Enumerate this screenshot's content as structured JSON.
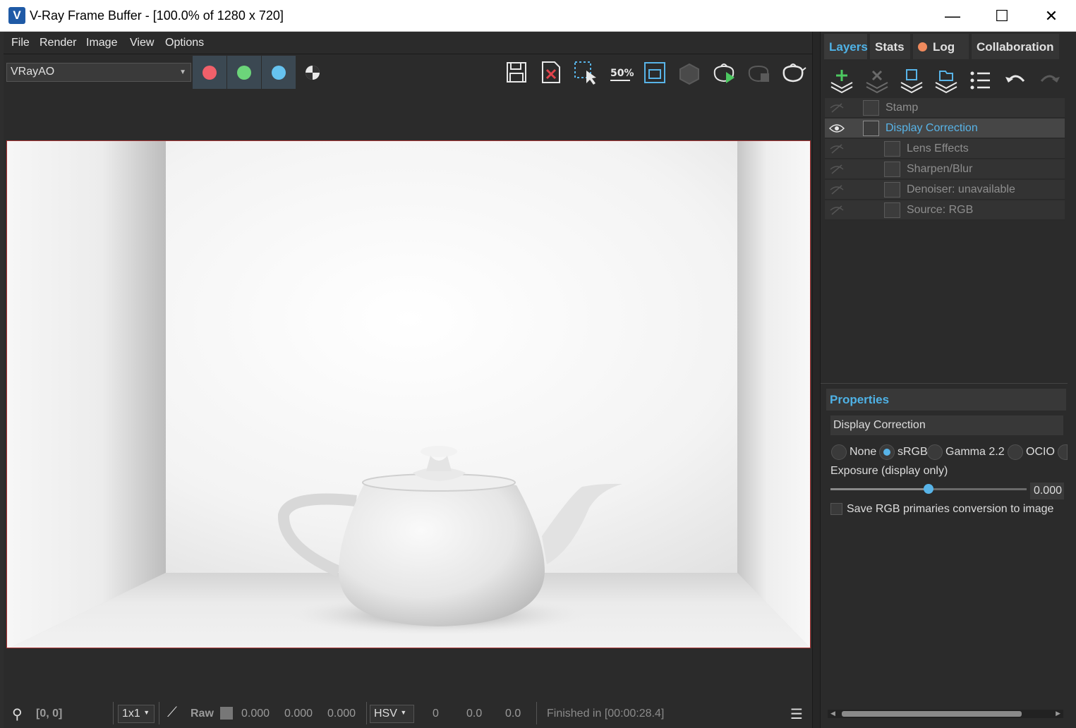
{
  "window": {
    "title": "V-Ray Frame Buffer - [100.0% of 1280 x 720]",
    "icon_letter": "V",
    "minimize": "—",
    "maximize": "☐",
    "close": "✕"
  },
  "menu": [
    "File",
    "Render",
    "Image",
    "View",
    "Options"
  ],
  "toolbar": {
    "channel": "VRayAO",
    "channel_dots": [
      {
        "name": "red-channel",
        "color": "#f0606a"
      },
      {
        "name": "green-channel",
        "color": "#6cd57a"
      },
      {
        "name": "blue-channel",
        "color": "#66c3f0"
      }
    ],
    "zoom_label": "50%",
    "icons": [
      "save-image-icon",
      "clear-image-icon",
      "region-select-icon",
      "zoom-50-icon",
      "track-mouse-icon",
      "render-region-icon",
      "interactive-render-icon",
      "stop-render-icon",
      "render-icon"
    ]
  },
  "statusbar": {
    "coords": "[0, 0]",
    "sample_size": "1x1",
    "mode": "Raw",
    "r": "0.000",
    "g": "0.000",
    "b": "0.000",
    "color_space": "HSV",
    "h": "0",
    "s": "0.0",
    "v": "0.0",
    "status": "Finished in [00:00:28.4]"
  },
  "panel": {
    "tabs": [
      "Layers",
      "Stats",
      "Log",
      "Collaboration"
    ],
    "layer_tools": [
      "add-layer-icon",
      "delete-layer-icon",
      "save-layers-icon",
      "load-layers-icon",
      "layer-list-icon",
      "undo-icon",
      "redo-icon"
    ],
    "layers": [
      {
        "label": "Stamp",
        "visible": false,
        "selected": false,
        "indent": 0
      },
      {
        "label": "Display Correction",
        "visible": true,
        "selected": true,
        "indent": 0
      },
      {
        "label": "Lens Effects",
        "visible": false,
        "selected": false,
        "indent": 1
      },
      {
        "label": "Sharpen/Blur",
        "visible": false,
        "selected": false,
        "indent": 1
      },
      {
        "label": "Denoiser: unavailable",
        "visible": false,
        "selected": false,
        "indent": 1
      },
      {
        "label": "Source: RGB",
        "visible": false,
        "selected": false,
        "indent": 1
      }
    ]
  },
  "properties": {
    "title": "Properties",
    "layer_name": "Display Correction",
    "options": [
      "None",
      "sRGB",
      "Gamma 2.2",
      "OCIO"
    ],
    "selected_option": "sRGB",
    "exposure_label": "Exposure (display only)",
    "exposure_value": "0.000",
    "exposure_fraction": 0.5,
    "save_rgb_label": "Save RGB primaries conversion to image",
    "save_rgb_checked": false
  },
  "colors": {
    "accent": "#4fb2e6",
    "log_dot": "#f08a5d"
  }
}
